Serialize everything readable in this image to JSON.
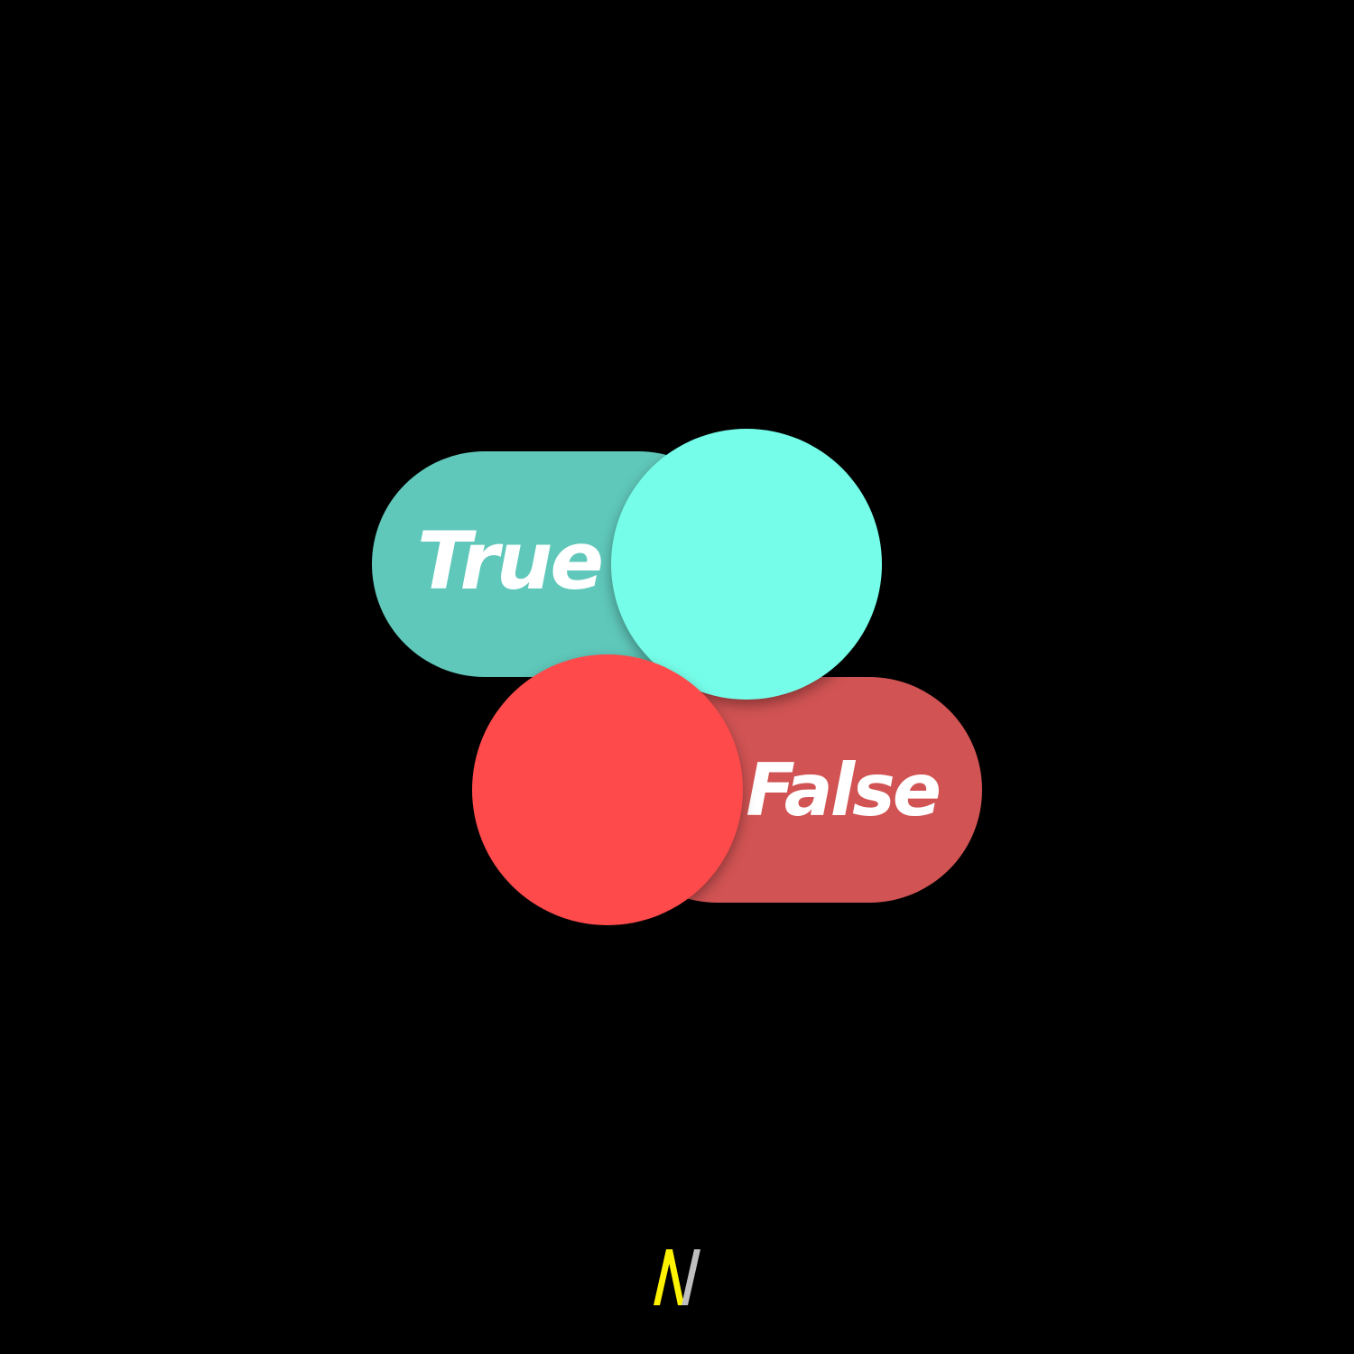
{
  "toggles": {
    "on": {
      "label": "True",
      "state": "on",
      "track_color": "#5FC8BA",
      "knob_color": "#76FDE9"
    },
    "off": {
      "label": "False",
      "state": "off",
      "track_color": "#D15353",
      "knob_color": "#FE4A4B"
    }
  },
  "logo": {
    "icon": "n-logo-icon",
    "colors": [
      "#FFF200",
      "#BFBFBF"
    ]
  },
  "background_color": "#000000"
}
